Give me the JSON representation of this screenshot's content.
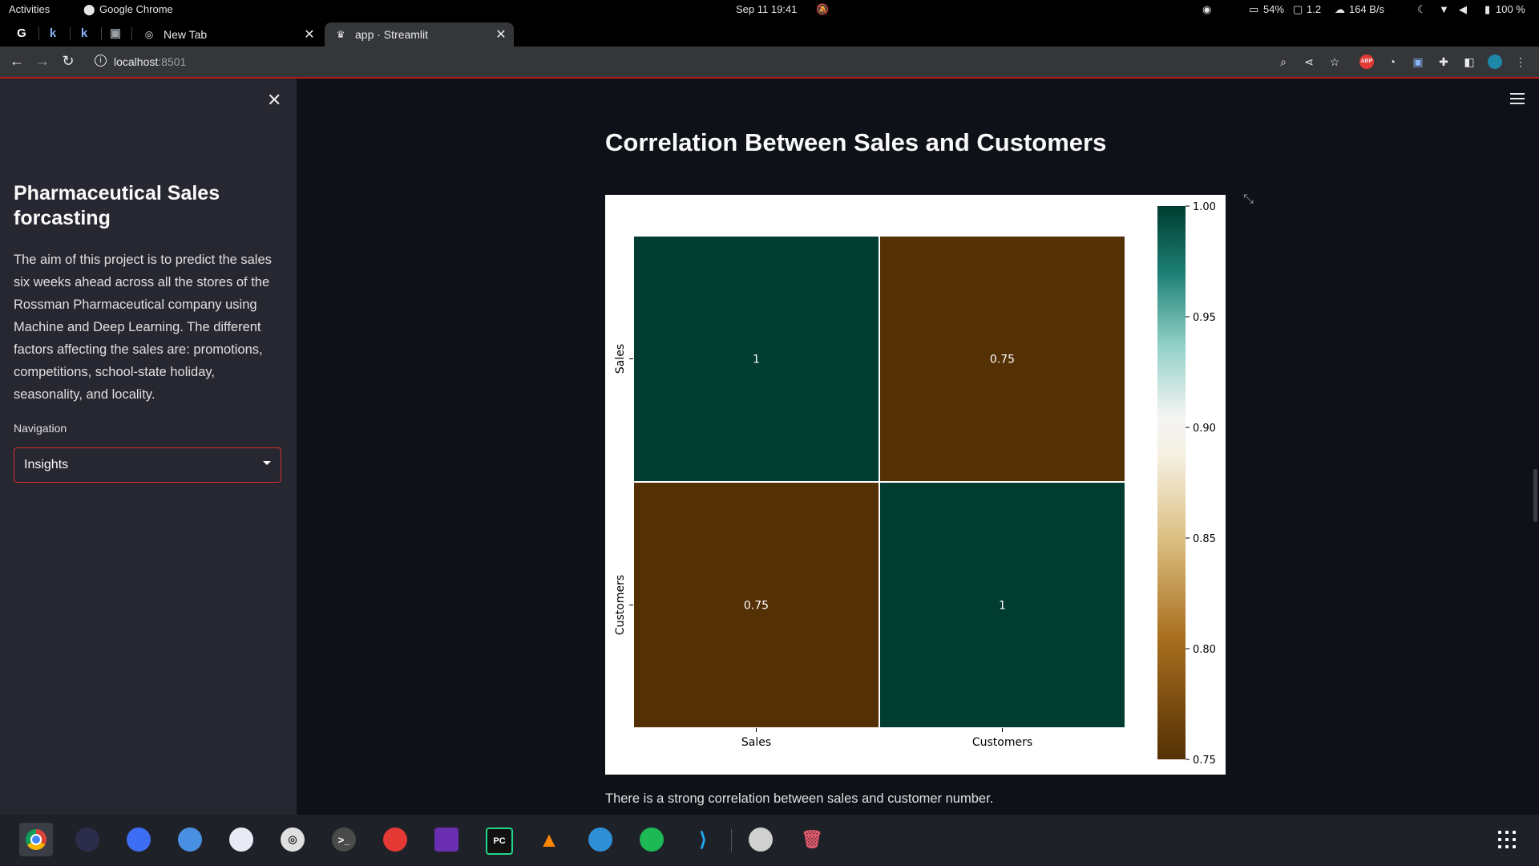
{
  "system_bar": {
    "activities": "Activities",
    "app_name": "Google Chrome",
    "datetime": "Sep 11  19:41",
    "cpu": "54%",
    "load": "1.2",
    "net": "164 B/s",
    "battery": "100 %"
  },
  "browser": {
    "tabs": [
      {
        "label": "New Tab",
        "icon": "chrome-icon",
        "active": false
      },
      {
        "label": "app · Streamlit",
        "icon": "streamlit-icon",
        "active": true
      }
    ],
    "pinned_tab_letters": [
      "k",
      "k"
    ],
    "url_host": "localhost",
    "url_port": ":8501",
    "extension_abp": "ABP"
  },
  "sidebar": {
    "title": "Pharmaceutical Sales forcasting",
    "description": "The aim of this project is to predict the sales six weeks ahead across all the stores of the Rossman Pharmaceutical company using Machine and Deep Learning. The different factors affecting the sales are: promotions, competitions, school-state holiday, seasonality, and locality.",
    "navigation_label": "Navigation",
    "navigation_value": "Insights"
  },
  "main": {
    "title": "Correlation Between Sales and Customers",
    "caption": "There is a strong correlation between sales and customer number."
  },
  "chart_data": {
    "type": "heatmap",
    "x": [
      "Sales",
      "Customers"
    ],
    "y": [
      "Sales",
      "Customers"
    ],
    "values": [
      [
        1,
        0.75
      ],
      [
        0.75,
        1
      ]
    ],
    "annotations": [
      [
        "1",
        "0.75"
      ],
      [
        "0.75",
        "1"
      ]
    ],
    "colormap": "BrBG",
    "colorbar": {
      "min": 0.75,
      "max": 1.0,
      "ticks": [
        "1.00",
        "0.95",
        "0.90",
        "0.85",
        "0.80",
        "0.75"
      ]
    },
    "colors": {
      "low": "#543005",
      "high": "#003c30",
      "line": "#ffffff"
    }
  },
  "dock": {
    "apps": [
      "chrome-icon",
      "eclipse-icon",
      "telegram-icon",
      "remote-icon",
      "disk-icon",
      "camera-icon",
      "terminal-icon",
      "pdf-icon",
      "github-icon",
      "pycharm-icon",
      "vlc-icon",
      "stellarium-icon",
      "spotify-icon",
      "vscode-icon",
      "drive-icon",
      "trash-icon"
    ],
    "pycharm_label": "PC",
    "terminal_label": ">_"
  }
}
